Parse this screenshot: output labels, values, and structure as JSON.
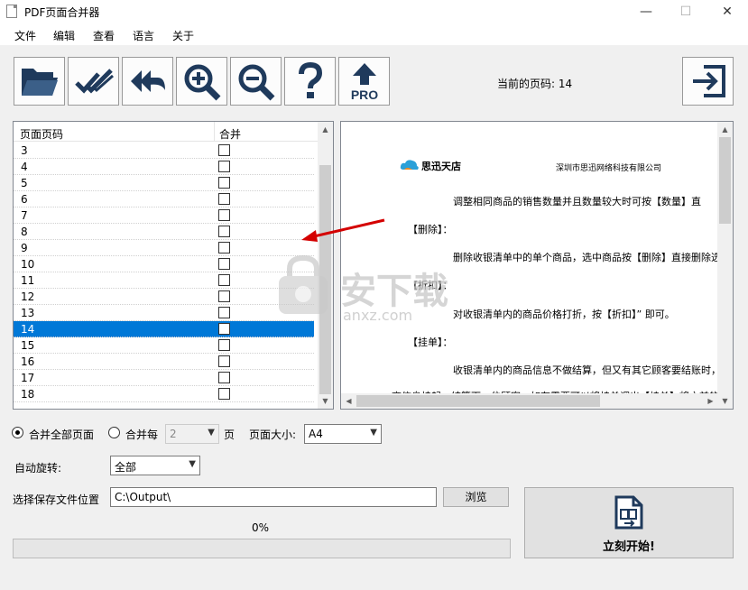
{
  "window": {
    "title": "PDF页面合并器",
    "minimize": "—",
    "maximize": "☐",
    "close": "✕"
  },
  "menu": [
    "文件",
    "编辑",
    "查看",
    "语言",
    "关于"
  ],
  "toolbar": {
    "buttons": [
      {
        "name": "open-folder",
        "icon": "folder-open-icon"
      },
      {
        "name": "check-all",
        "icon": "double-check-icon"
      },
      {
        "name": "back",
        "icon": "double-back-arrow-icon"
      },
      {
        "name": "zoom-in",
        "icon": "zoom-in-icon"
      },
      {
        "name": "zoom-out",
        "icon": "zoom-out-icon"
      },
      {
        "name": "help",
        "icon": "question-icon"
      },
      {
        "name": "upgrade-pro",
        "icon": "up-arrow-pro-icon",
        "label": "PRO"
      }
    ],
    "exit_icon": "exit-arrow-icon"
  },
  "current_page": {
    "label": "当前的页码: 14"
  },
  "page_list": {
    "headers": {
      "page": "页面页码",
      "merge": "合并"
    },
    "rows": [
      {
        "page": "3",
        "merge": false,
        "selected": false
      },
      {
        "page": "4",
        "merge": false,
        "selected": false
      },
      {
        "page": "5",
        "merge": false,
        "selected": false
      },
      {
        "page": "6",
        "merge": false,
        "selected": false
      },
      {
        "page": "7",
        "merge": false,
        "selected": false
      },
      {
        "page": "8",
        "merge": false,
        "selected": false
      },
      {
        "page": "9",
        "merge": false,
        "selected": false
      },
      {
        "page": "10",
        "merge": false,
        "selected": false
      },
      {
        "page": "11",
        "merge": false,
        "selected": false
      },
      {
        "page": "12",
        "merge": false,
        "selected": false
      },
      {
        "page": "13",
        "merge": false,
        "selected": false
      },
      {
        "page": "14",
        "merge": false,
        "selected": true
      },
      {
        "page": "15",
        "merge": false,
        "selected": false
      },
      {
        "page": "16",
        "merge": false,
        "selected": false
      },
      {
        "page": "17",
        "merge": false,
        "selected": false
      },
      {
        "page": "18",
        "merge": false,
        "selected": false
      }
    ]
  },
  "preview": {
    "brand": "思迅天店",
    "company": "深圳市思迅网络科技有限公司",
    "line1": "调整相同商品的销售数量并且数量较大时可按【数量】直",
    "h_delete": "【删除】：",
    "line2": "删除收银清单中的单个商品，选中商品按【删除】直接删除选中",
    "h_discount": "【折扣】：",
    "line3": "对收银清单内的商品价格打折，按【折扣】” 即可。",
    "h_hold": "【挂单】：",
    "line4": "收银清单内的商品信息不做结算，但又有其它顾客要结账时，可",
    "line5": "商信息挂起，结算下一位顾客，如有需要可以将挂单调出【挂单】将之前的商品取",
    "watermark": "安下载",
    "watermark_sub": "anxz.com"
  },
  "options": {
    "merge_all_label": "合并全部页面",
    "merge_every_label": "合并每",
    "merge_every_value": "2",
    "page_unit": "页",
    "page_size_label": "页面大小:",
    "page_size_value": "A4",
    "auto_rotate_label": "自动旋转:",
    "auto_rotate_value": "全部",
    "save_location_label": "选择保存文件位置",
    "save_path": "C:\\Output\\",
    "browse_label": "浏览",
    "progress_text": "0%",
    "progress_value": 0,
    "start_label": "立刻开始!"
  },
  "colors": {
    "selected": "#0078d7",
    "icon": "#1f3a5c",
    "annotation_arrow": "#d40000"
  }
}
